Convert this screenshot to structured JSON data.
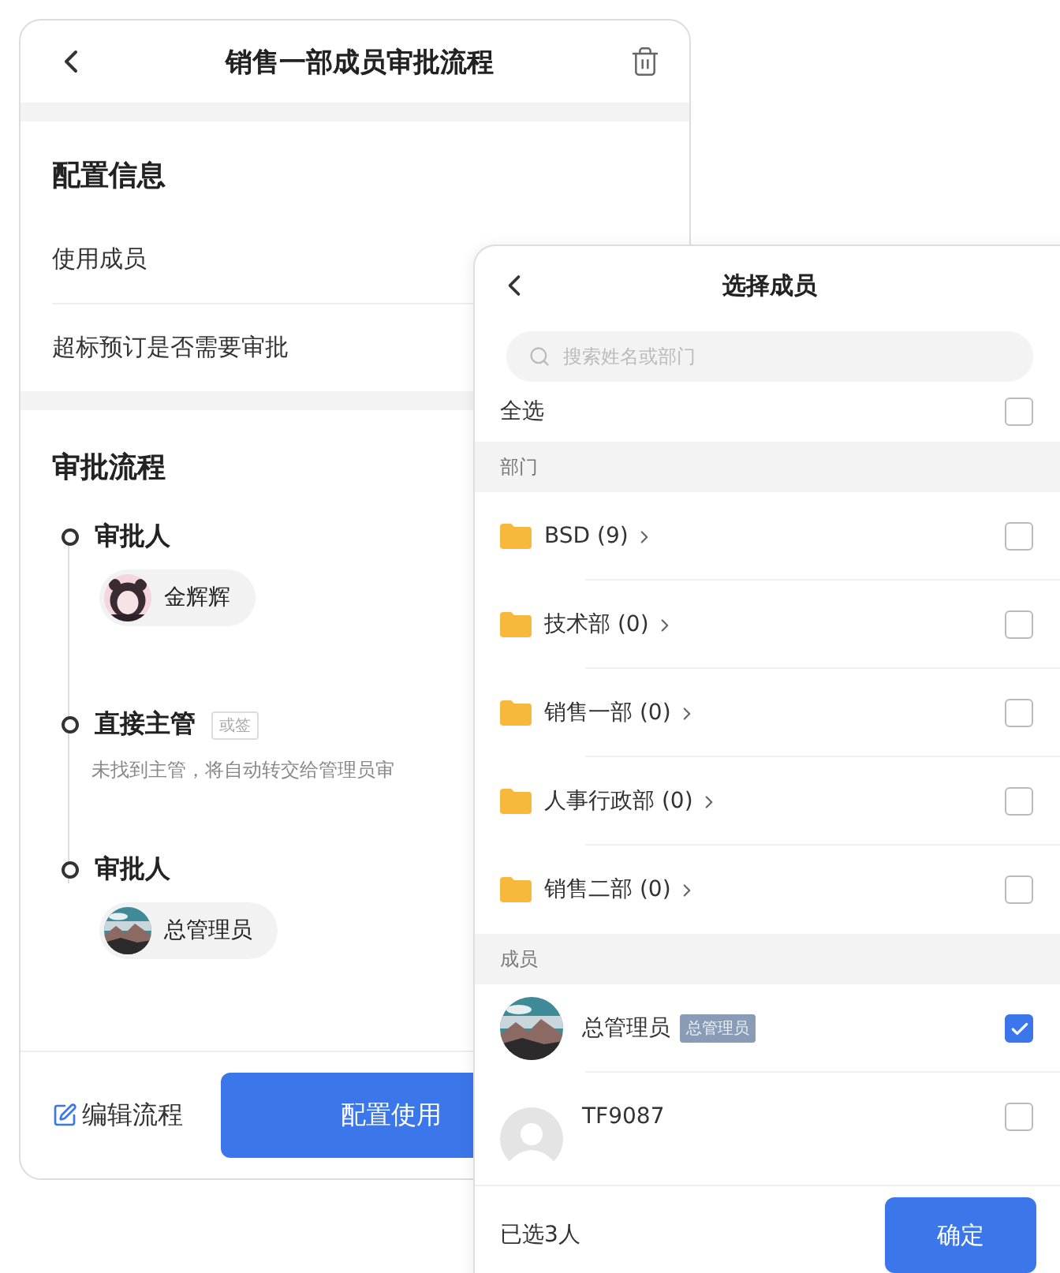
{
  "page": {
    "title": "销售一部成员审批流程"
  },
  "config": {
    "heading": "配置信息",
    "rows": [
      "使用成员",
      "超标预订是否需要审批"
    ]
  },
  "flow": {
    "heading": "审批流程",
    "steps": [
      {
        "title": "审批人",
        "approver": {
          "name": "金辉辉"
        }
      },
      {
        "title": "直接主管",
        "tag": "或签",
        "note": "未找到主管，将自动转交给管理员审"
      },
      {
        "title": "审批人",
        "approver": {
          "name": "总管理员"
        }
      }
    ]
  },
  "footer": {
    "edit_link": "编辑流程",
    "primary_button": "配置使用"
  },
  "picker": {
    "title": "选择成员",
    "search": {
      "placeholder": "搜索姓名或部门"
    },
    "select_all": {
      "label": "全选",
      "checked": false
    },
    "departments": {
      "heading": "部门",
      "items": [
        {
          "name": "BSD (9)",
          "checked": false
        },
        {
          "name": "技术部 (0)",
          "checked": false
        },
        {
          "name": "销售一部 (0)",
          "checked": false
        },
        {
          "name": "人事行政部 (0)",
          "checked": false
        },
        {
          "name": "销售二部 (0)",
          "checked": false
        }
      ]
    },
    "members": {
      "heading": "成员",
      "items": [
        {
          "name": "总管理员",
          "badge": "总管理员",
          "checked": true
        },
        {
          "kind": "placeholder",
          "name": "TF9087",
          "checked": false
        }
      ]
    },
    "summary": "已选3人",
    "confirm": "确定"
  }
}
